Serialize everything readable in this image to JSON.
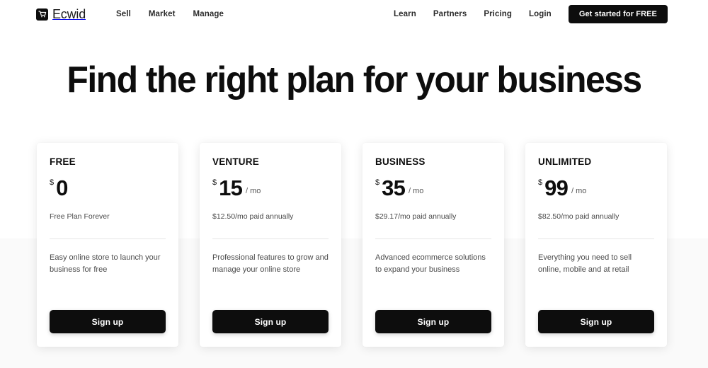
{
  "header": {
    "logo_text": "Ecwid",
    "logo_icon": "shopping-cart-icon",
    "nav_left": [
      {
        "label": "Sell"
      },
      {
        "label": "Market"
      },
      {
        "label": "Manage"
      }
    ],
    "nav_right": [
      {
        "label": "Learn"
      },
      {
        "label": "Partners"
      },
      {
        "label": "Pricing"
      },
      {
        "label": "Login"
      }
    ],
    "cta_label": "Get started for FREE"
  },
  "hero": {
    "title": "Find the right plan for your business"
  },
  "colors": {
    "accent_highlight": "#f7e23c",
    "button_bg": "#0d0d0d",
    "button_text": "#ffffff",
    "page_bg": "#ffffff",
    "band_bg": "#fafafa",
    "card_bg": "#ffffff",
    "divider": "#e6e6e6"
  },
  "plans": [
    {
      "name": "FREE",
      "currency": "$",
      "amount": "0",
      "period": "",
      "note": "Free Plan Forever",
      "description": "Easy online store to launch your business for free",
      "cta_label": "Sign up"
    },
    {
      "name": "VENTURE",
      "currency": "$",
      "amount": "15",
      "period": "/ mo",
      "note": "$12.50/mo paid annually",
      "description": "Professional features to grow and manage your online store",
      "cta_label": "Sign up"
    },
    {
      "name": "BUSINESS",
      "currency": "$",
      "amount": "35",
      "period": "/ mo",
      "note": "$29.17/mo paid annually",
      "description": "Advanced ecommerce solutions to expand your business",
      "cta_label": "Sign up"
    },
    {
      "name": "UNLIMITED",
      "currency": "$",
      "amount": "99",
      "period": "/ mo",
      "note": "$82.50/mo paid annually",
      "description": "Everything you need to sell online, mobile and at retail",
      "cta_label": "Sign up"
    }
  ]
}
